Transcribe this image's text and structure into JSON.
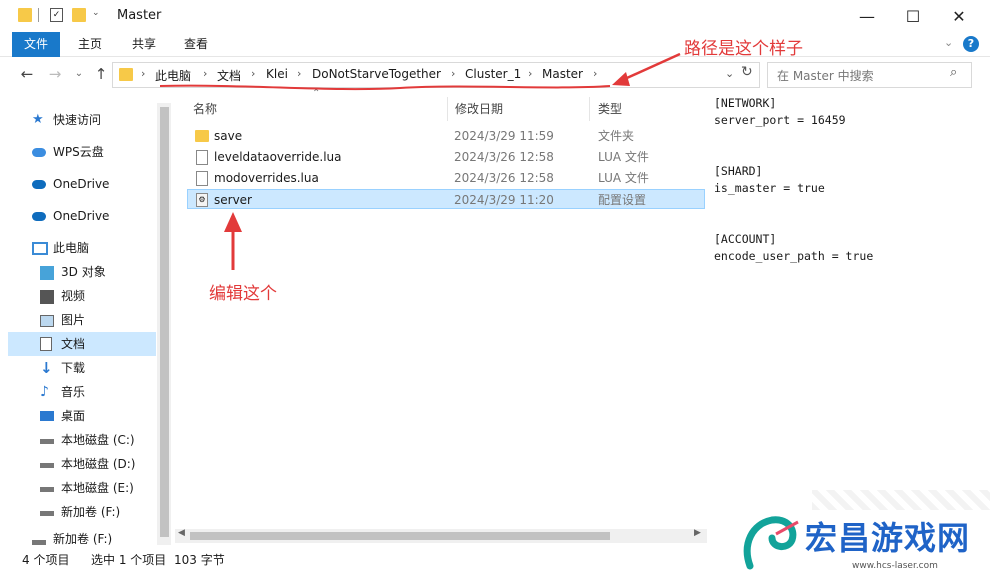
{
  "window": {
    "title": "Master",
    "controls": {
      "minimize": "—",
      "maximize": "☐",
      "close": "✕"
    }
  },
  "ribbon": {
    "file_tab": "文件",
    "tabs": [
      "主页",
      "共享",
      "查看"
    ],
    "help": "?"
  },
  "address": {
    "crumbs": [
      "此电脑",
      "文档",
      "Klei",
      "DoNotStarveTogether",
      "Cluster_1",
      "Master"
    ],
    "search_placeholder": "在 Master 中搜索"
  },
  "sidebar": {
    "items": [
      {
        "label": "快速访问",
        "icon": "star-icon"
      },
      {
        "label": "WPS云盘",
        "icon": "cloud-icon"
      },
      {
        "label": "OneDrive",
        "icon": "cloud-icon"
      },
      {
        "label": "OneDrive",
        "icon": "cloud-icon"
      },
      {
        "label": "此电脑",
        "icon": "computer-icon"
      },
      {
        "label": "3D 对象",
        "icon": "cube-icon"
      },
      {
        "label": "视频",
        "icon": "video-icon"
      },
      {
        "label": "图片",
        "icon": "picture-icon"
      },
      {
        "label": "文档",
        "icon": "document-icon"
      },
      {
        "label": "下载",
        "icon": "download-icon"
      },
      {
        "label": "音乐",
        "icon": "music-icon"
      },
      {
        "label": "桌面",
        "icon": "desktop-icon"
      },
      {
        "label": "本地磁盘 (C:)",
        "icon": "drive-icon"
      },
      {
        "label": "本地磁盘 (D:)",
        "icon": "drive-icon"
      },
      {
        "label": "本地磁盘 (E:)",
        "icon": "drive-icon"
      },
      {
        "label": "新加卷 (F:)",
        "icon": "drive-icon"
      },
      {
        "label": "新加卷 (F:)",
        "icon": "drive-icon"
      }
    ]
  },
  "filelist": {
    "columns": [
      "名称",
      "修改日期",
      "类型"
    ],
    "rows": [
      {
        "name": "save",
        "date": "2024/3/29 11:59",
        "type": "文件夹",
        "icon": "folder-icon"
      },
      {
        "name": "leveldataoverride.lua",
        "date": "2024/3/26 12:58",
        "type": "LUA 文件",
        "icon": "file-icon"
      },
      {
        "name": "modoverrides.lua",
        "date": "2024/3/26 12:58",
        "type": "LUA 文件",
        "icon": "file-icon"
      },
      {
        "name": "server",
        "date": "2024/3/29 11:20",
        "type": "配置设置",
        "icon": "settings-file-icon"
      }
    ]
  },
  "preview": {
    "lines": [
      "[NETWORK]",
      "server_port = 16459",
      "",
      "",
      "[SHARD]",
      "is_master = true",
      "",
      "",
      "[ACCOUNT]",
      "encode_user_path = true"
    ]
  },
  "status": {
    "count": "4 个项目",
    "selected": "选中 1 个项目",
    "size": "103 字节"
  },
  "annotations": {
    "path_note": "路径是这个样子",
    "edit_note": "编辑这个"
  },
  "watermark": {
    "text": "宏昌游戏网",
    "url": "www.hcs-laser.com"
  }
}
